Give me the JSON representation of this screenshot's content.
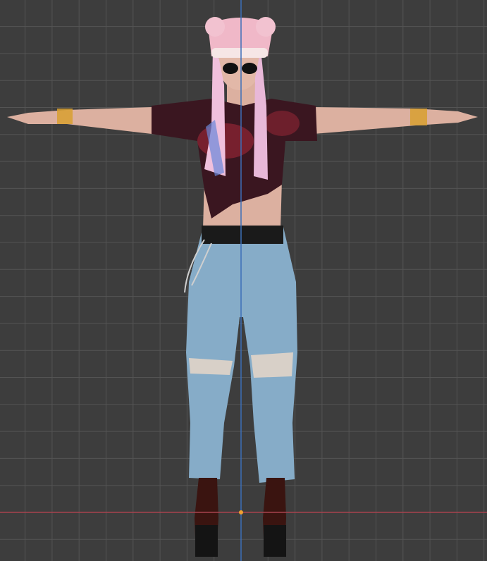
{
  "viewport": {
    "view": "front-orthographic",
    "grid": true,
    "colors": {
      "background": "#3d3d3d",
      "grid_line": "#545454",
      "x_axis": "#a8434f",
      "z_axis": "#3d6fb8",
      "origin": "#f0a030"
    },
    "model": {
      "pose": "T-pose",
      "colors": {
        "skin": "#e2b8a8",
        "hair": "#f0c0dc",
        "hat": "#f0b8c8",
        "shirt": "#3a1620",
        "shirt_accent": "#b02838",
        "jeans": "#86acc8",
        "belt": "#1a1a1a",
        "boots": "#3a1410",
        "sunglasses": "#111111"
      }
    }
  }
}
